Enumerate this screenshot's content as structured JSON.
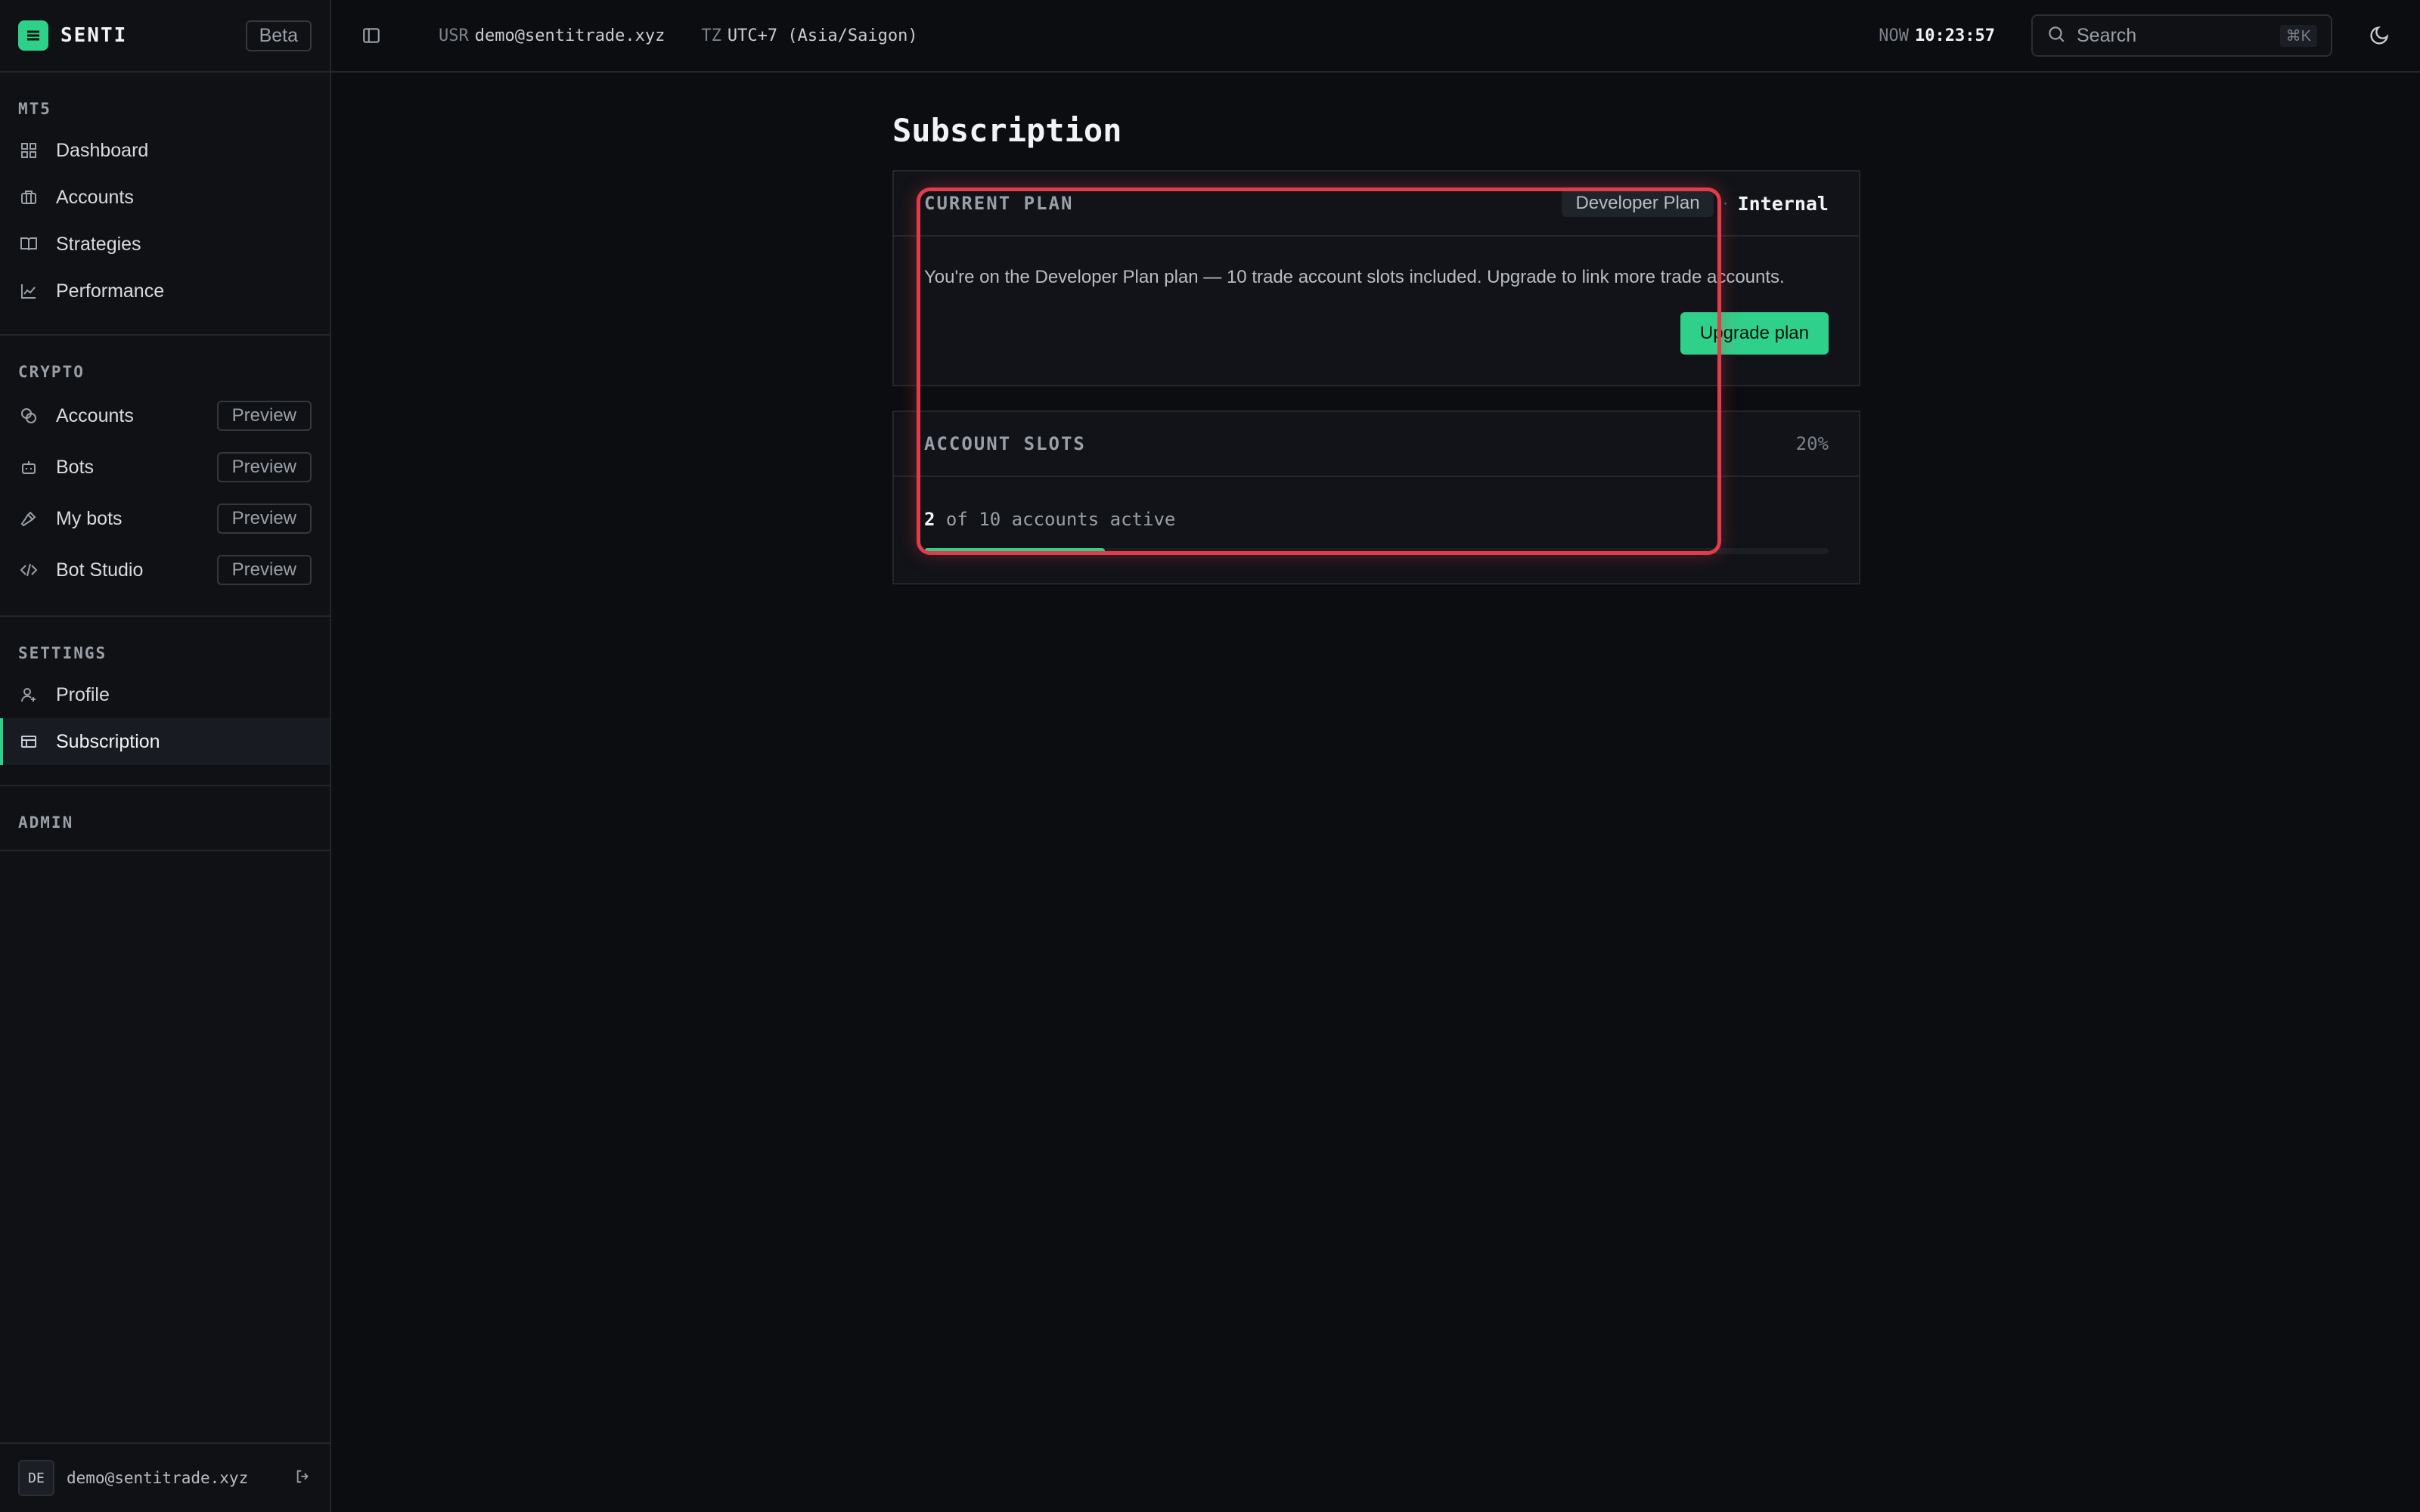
{
  "brand": {
    "name": "SENTI",
    "badge": "Beta"
  },
  "sidebar": {
    "sections": [
      {
        "title": "MT5",
        "items": [
          {
            "label": "Dashboard",
            "icon": "dashboard-icon"
          },
          {
            "label": "Accounts",
            "icon": "briefcase-icon"
          },
          {
            "label": "Strategies",
            "icon": "book-icon"
          },
          {
            "label": "Performance",
            "icon": "chart-line-icon"
          }
        ]
      },
      {
        "title": "CRYPTO",
        "items": [
          {
            "label": "Accounts",
            "icon": "coins-icon",
            "badge": "Preview"
          },
          {
            "label": "Bots",
            "icon": "bot-icon",
            "badge": "Preview"
          },
          {
            "label": "My bots",
            "icon": "hammer-icon",
            "badge": "Preview"
          },
          {
            "label": "Bot Studio",
            "icon": "code-icon",
            "badge": "Preview"
          }
        ]
      },
      {
        "title": "SETTINGS",
        "items": [
          {
            "label": "Profile",
            "icon": "user-cog-icon"
          },
          {
            "label": "Subscription",
            "icon": "card-icon",
            "active": true
          }
        ]
      },
      {
        "title": "ADMIN",
        "items": []
      }
    ],
    "footer": {
      "avatar": "DE",
      "email": "demo@sentitrade.xyz"
    }
  },
  "topbar": {
    "usr_label": "USR",
    "usr_value": "demo@sentitrade.xyz",
    "tz_label": "TZ",
    "tz_value": "UTC+7 (Asia/Saigon)",
    "now_label": "NOW",
    "now_value": "10:23:57",
    "search_placeholder": "Search",
    "search_shortcut": "⌘K"
  },
  "main": {
    "title": "Subscription",
    "plan_card": {
      "title": "CURRENT PLAN",
      "plan_name": "Developer Plan",
      "separator": "·",
      "tier": "Internal",
      "description": "You're on the Developer Plan plan — 10 trade account slots included. Upgrade to link more trade accounts.",
      "upgrade_label": "Upgrade plan"
    },
    "slots_card": {
      "title": "ACCOUNT SLOTS",
      "percent_label": "20%",
      "used": "2",
      "rest_text": " of 10 accounts active",
      "fill_fraction": 0.2
    }
  },
  "colors": {
    "accent": "#2fd08a",
    "highlight": "#e23b4a",
    "background": "#0b0d11"
  }
}
